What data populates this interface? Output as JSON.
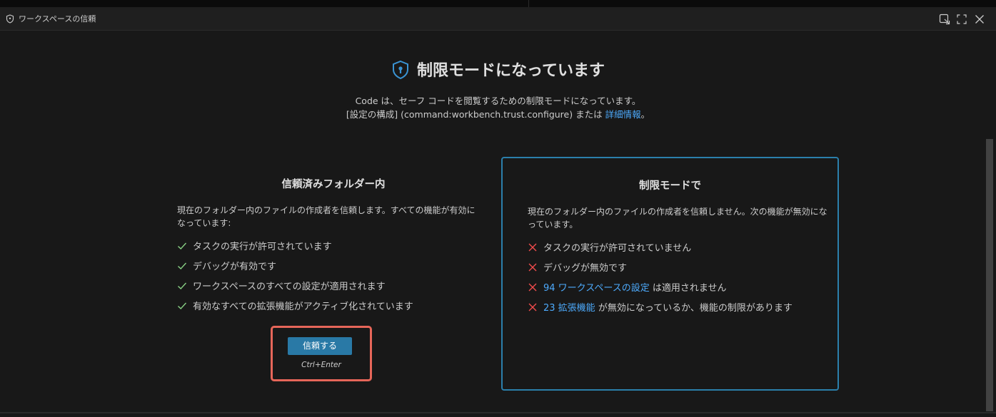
{
  "tab": {
    "title": "ワークスペースの信頼",
    "icon": "shield-icon",
    "actions": [
      "open-changes-icon",
      "maximize-icon",
      "close-icon"
    ]
  },
  "main": {
    "heading": "制限モードになっています",
    "description_line1": "Code は、セーフ コードを閲覧するための制限モードになっています。",
    "description_line2_prefix": "[設定の構成] (command:workbench.trust.configure) または ",
    "description_link": "詳細情報",
    "description_suffix": "。"
  },
  "trusted": {
    "title": "信頼済みフォルダー内",
    "description": "現在のフォルダー内のファイルの作成者を信頼します。すべての機能が有効になっています:",
    "items": [
      "タスクの実行が許可されています",
      "デバッグが有効です",
      "ワークスペースのすべての設定が適用されます",
      "有効なすべての拡張機能がアクティブ化されています"
    ],
    "button_label": "信頼する",
    "shortcut": "Ctrl+Enter"
  },
  "restricted": {
    "title": "制限モードで",
    "description": "現在のフォルダー内のファイルの作成者を信頼しません。次の機能が無効になっています。",
    "item0": "タスクの実行が許可されていません",
    "item1": "デバッグが無効です",
    "item2_link": "94 ワークスペースの設定",
    "item2_rest": " は適用されません",
    "item3_link": "23 拡張機能",
    "item3_rest": " が無効になっているか、機能の制限があります"
  },
  "colors": {
    "check": "#89d185",
    "cross": "#f14c4c",
    "link": "#4daafc",
    "accent_border": "#2b7fab",
    "button": "#2979a6",
    "highlight": "#e66659"
  }
}
